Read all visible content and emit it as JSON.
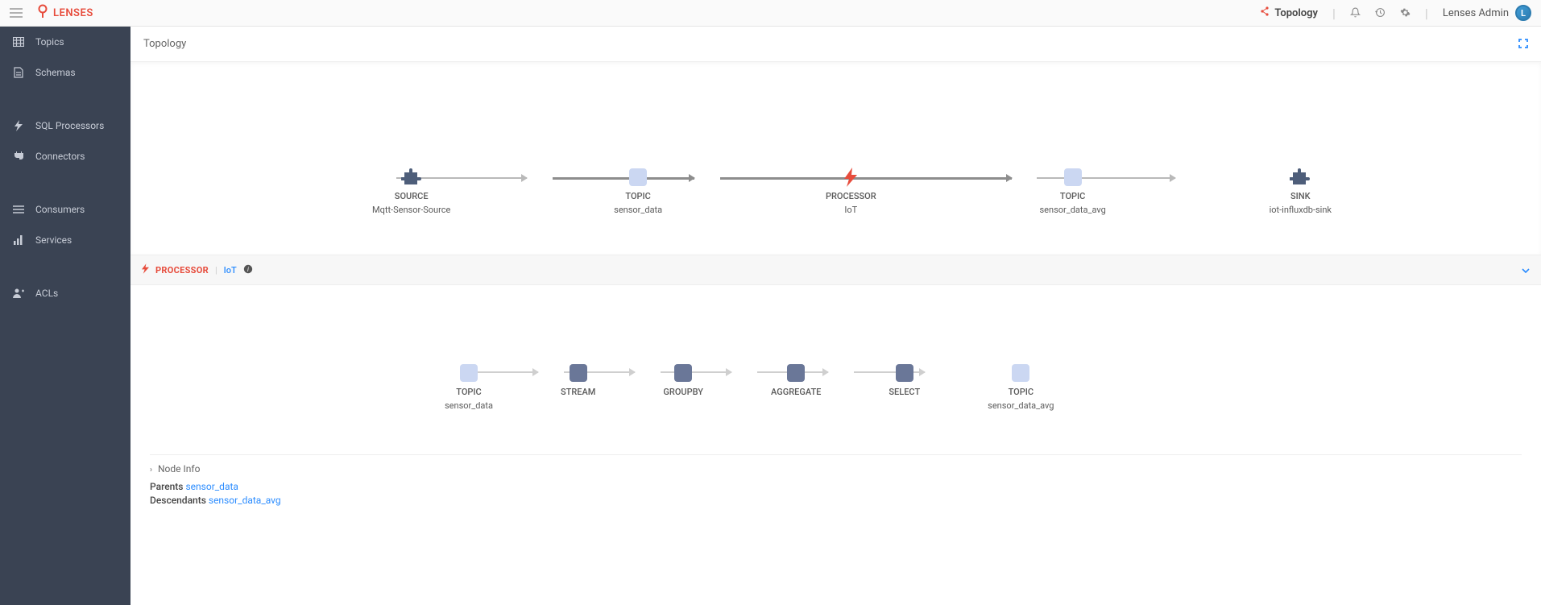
{
  "header": {
    "brand": "LENSES",
    "topology_label": "Topology",
    "user_name": "Lenses Admin",
    "avatar_letter": "L"
  },
  "sidebar": {
    "items": [
      {
        "label": "Topics"
      },
      {
        "label": "Schemas"
      },
      {
        "label": "SQL Processors"
      },
      {
        "label": "Connectors"
      },
      {
        "label": "Consumers"
      },
      {
        "label": "Services"
      },
      {
        "label": "ACLs"
      }
    ]
  },
  "page": {
    "title": "Topology"
  },
  "topology": {
    "nodes": [
      {
        "type": "SOURCE",
        "name": "Mqtt-Sensor-Source"
      },
      {
        "type": "TOPIC",
        "name": "sensor_data"
      },
      {
        "type": "PROCESSOR",
        "name": "IoT"
      },
      {
        "type": "TOPIC",
        "name": "sensor_data_avg"
      },
      {
        "type": "SINK",
        "name": "iot-influxdb-sink"
      }
    ]
  },
  "processor_panel": {
    "label": "PROCESSOR",
    "name": "IoT",
    "nodes": [
      {
        "type": "TOPIC",
        "name": "sensor_data"
      },
      {
        "type": "STREAM",
        "name": ""
      },
      {
        "type": "GROUPBY",
        "name": ""
      },
      {
        "type": "AGGREGATE",
        "name": ""
      },
      {
        "type": "SELECT",
        "name": ""
      },
      {
        "type": "TOPIC",
        "name": "sensor_data_avg"
      }
    ]
  },
  "node_info": {
    "title": "Node Info",
    "parents_label": "Parents",
    "parents_value": "sensor_data",
    "descendants_label": "Descendants",
    "descendants_value": "sensor_data_avg"
  }
}
